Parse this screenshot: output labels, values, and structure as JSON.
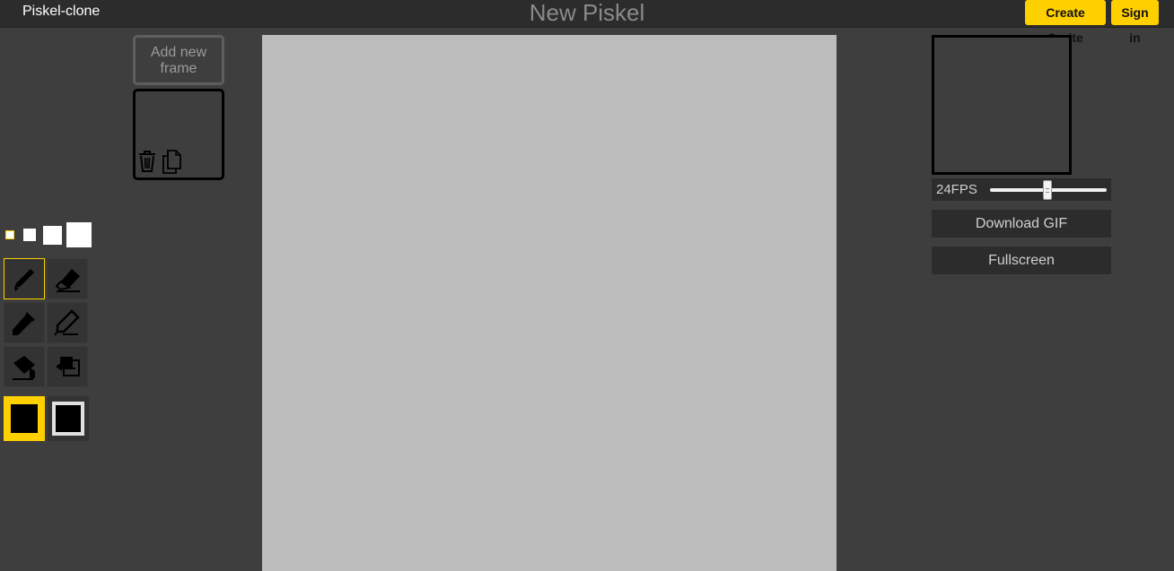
{
  "header": {
    "brand": "Piskel-clone",
    "title": "New Piskel",
    "create_sprite_label": "Create Sprite",
    "sign_in_label": "Sign in"
  },
  "frames": {
    "add_frame_label": "Add new frame",
    "items": [
      {
        "selected": true
      }
    ]
  },
  "tools": {
    "pen_sizes": [
      1,
      2,
      3,
      4
    ],
    "selected_pen_size": 1,
    "items": [
      {
        "name": "pen",
        "icon": "pencil-icon",
        "selected": true
      },
      {
        "name": "eraser",
        "icon": "eraser-icon",
        "selected": false
      },
      {
        "name": "color-picker",
        "icon": "eyedropper-icon",
        "selected": false
      },
      {
        "name": "stroke",
        "icon": "marker-icon",
        "selected": false
      },
      {
        "name": "paint-bucket",
        "icon": "paint-bucket-icon",
        "selected": false
      },
      {
        "name": "swap",
        "icon": "swap-layers-icon",
        "selected": false
      }
    ]
  },
  "colors": {
    "primary": "#000000",
    "secondary": "#000000",
    "accent": "#ffd000"
  },
  "preview": {
    "fps_label": "24FPS",
    "fps_value": 24,
    "download_gif_label": "Download GIF",
    "fullscreen_label": "Fullscreen"
  }
}
